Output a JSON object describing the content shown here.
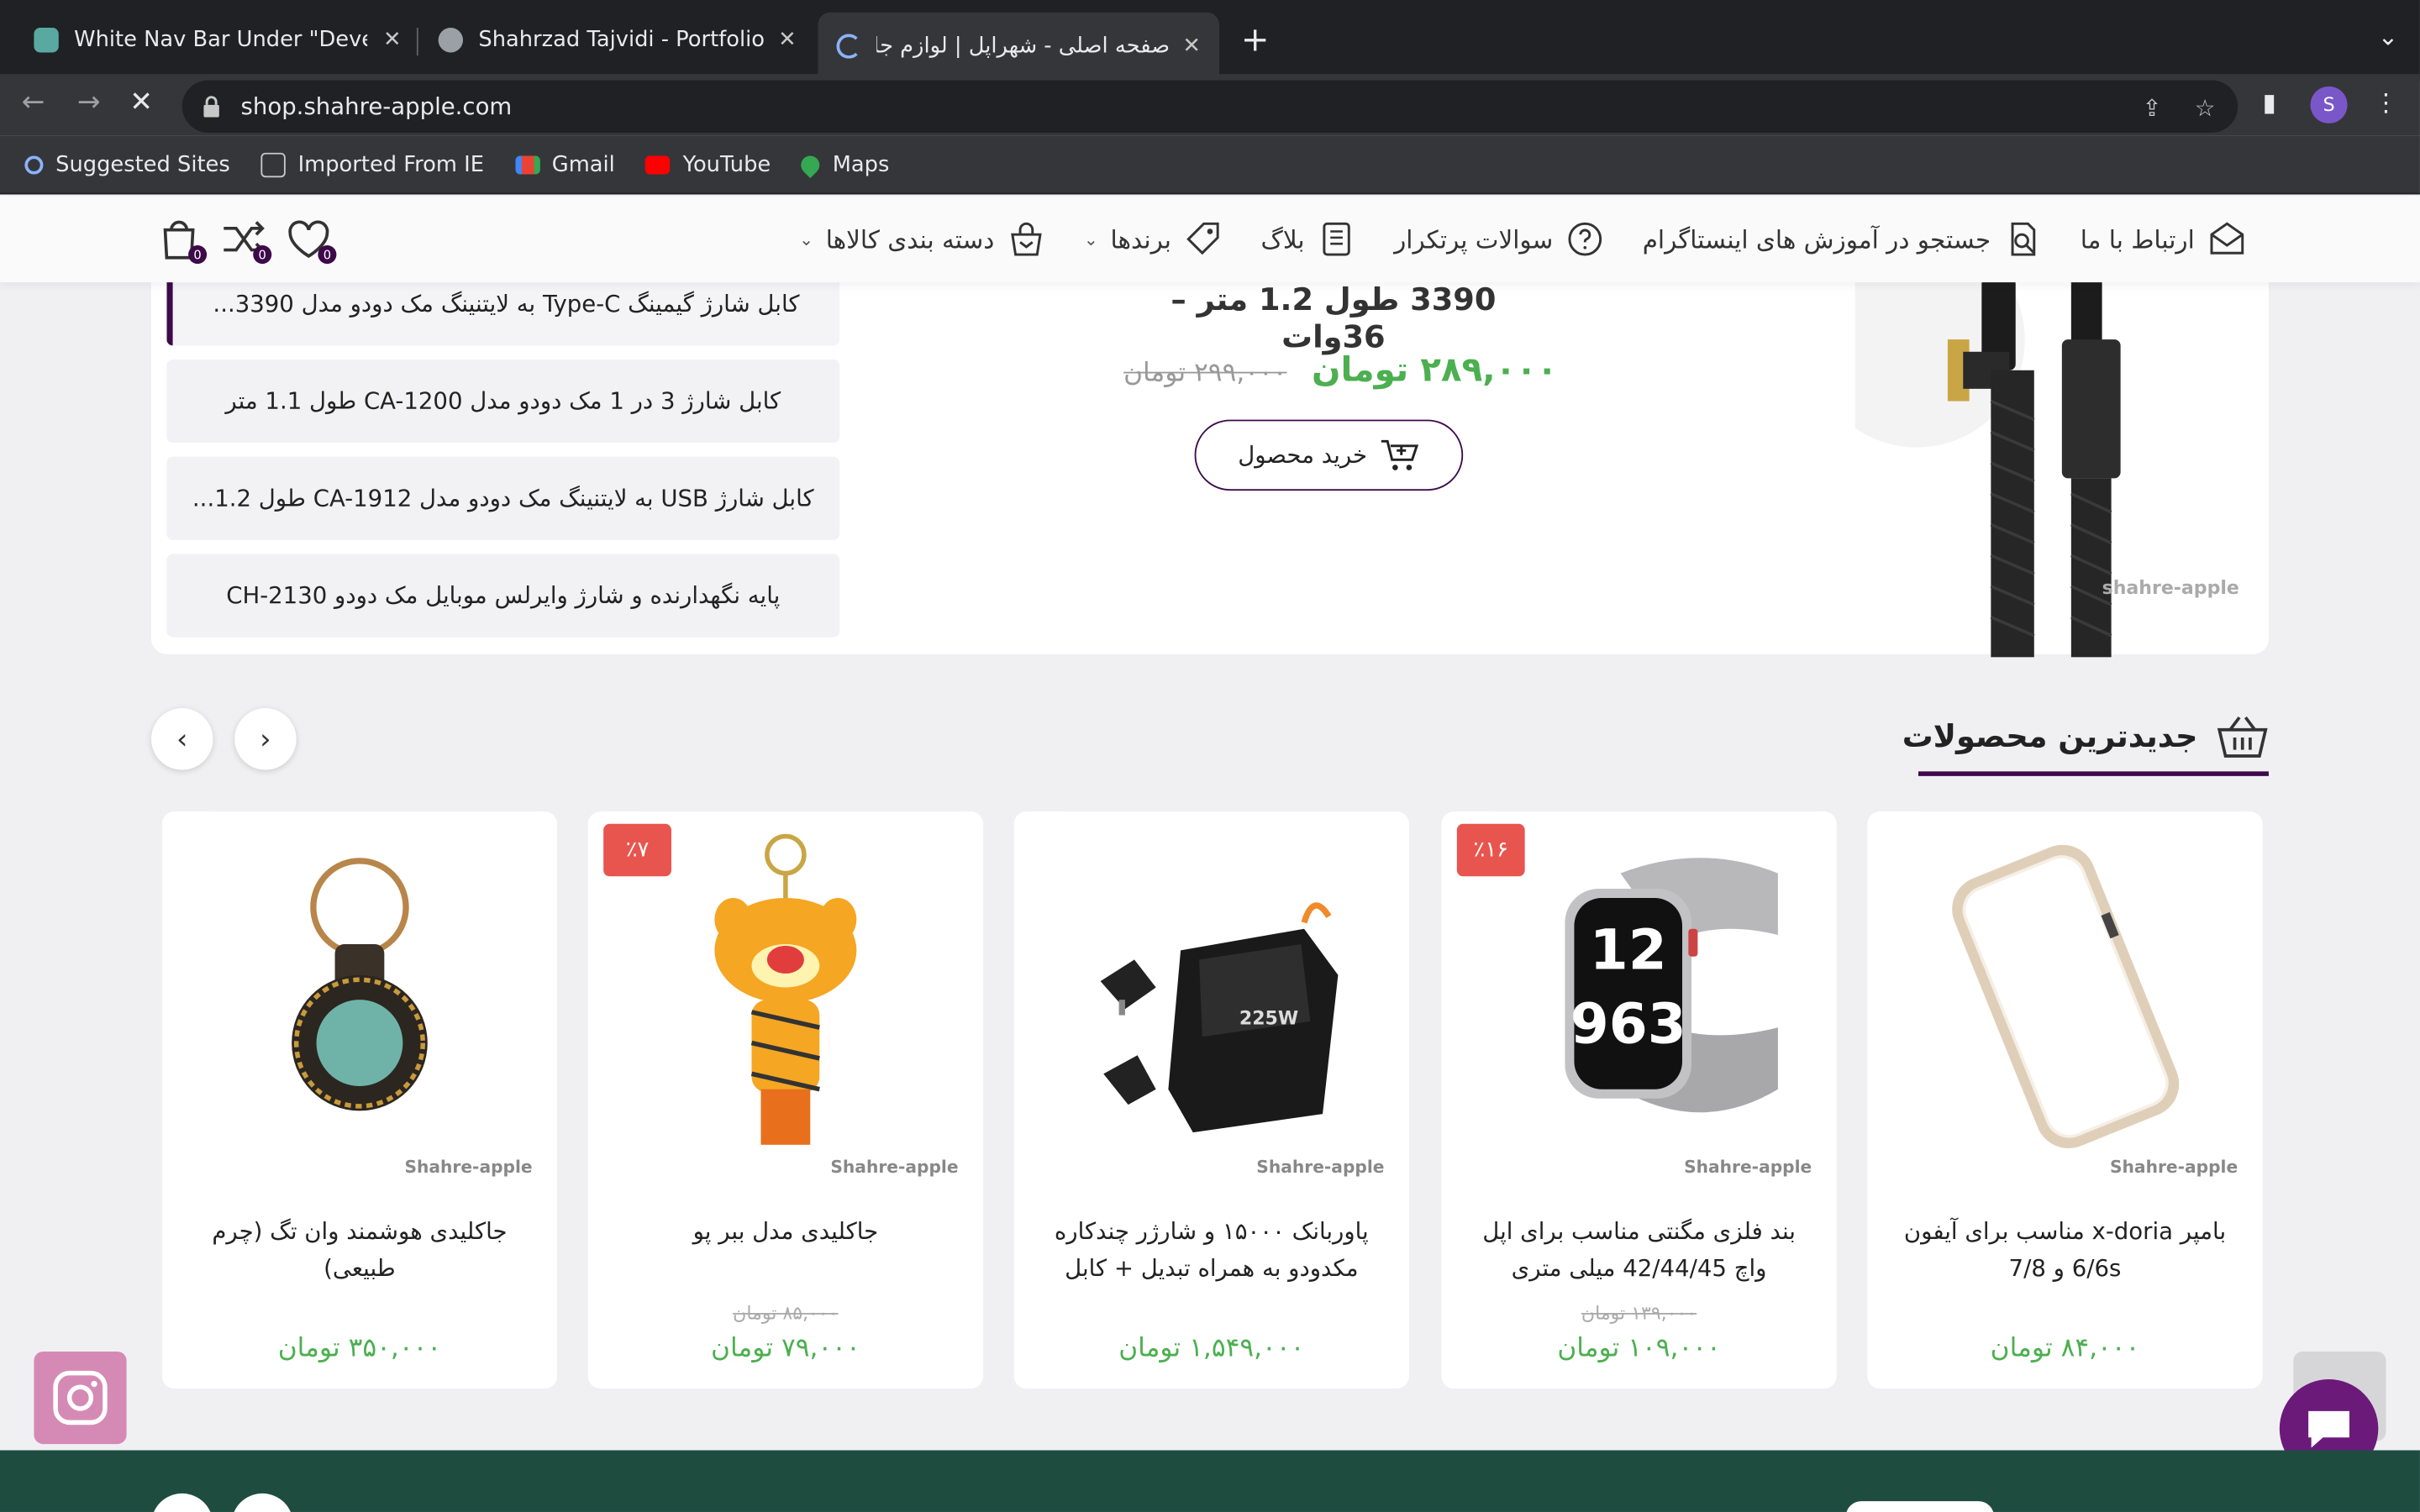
{
  "browser": {
    "tabs": [
      {
        "title": "White Nav Bar Under \"Develop",
        "close": "✕"
      },
      {
        "title": "Shahrzad Tajvidi - Portfolio",
        "close": "✕"
      },
      {
        "title": "صفحه اصلی - شهراپل | لوازم جانبی ا",
        "close": "✕"
      }
    ],
    "new_tab": "+",
    "url": "shop.shahre-apple.com",
    "avatar_letter": "S",
    "bookmarks": [
      {
        "label": "Suggested Sites",
        "icon": "search-icon"
      },
      {
        "label": "Imported From IE",
        "icon": "folder-icon"
      },
      {
        "label": "Gmail",
        "icon": "gmail-icon"
      },
      {
        "label": "YouTube",
        "icon": "youtube-icon"
      },
      {
        "label": "Maps",
        "icon": "maps-icon"
      }
    ]
  },
  "site": {
    "nav": [
      {
        "label": "دسته بندی کالاها",
        "icon": "shopping-bag-icon",
        "dropdown": true
      },
      {
        "label": "برندها",
        "icon": "tag-icon",
        "dropdown": true
      },
      {
        "label": "بلاگ",
        "icon": "blog-icon",
        "dropdown": false
      },
      {
        "label": "سوالات پرتکرار",
        "icon": "question-icon",
        "dropdown": false
      },
      {
        "label": "جستجو در آموزش های اینستاگرام",
        "icon": "search-doc-icon",
        "dropdown": false
      },
      {
        "label": "ارتباط با ما",
        "icon": "mail-icon",
        "dropdown": false
      }
    ],
    "header_icons": [
      {
        "name": "cart-icon",
        "count": "0"
      },
      {
        "name": "compare-icon",
        "count": "0"
      },
      {
        "name": "wishlist-icon",
        "count": "0"
      }
    ],
    "colors": {
      "accent": "#3d0a4a",
      "price": "#4caf50",
      "badge": "#e8554e",
      "footer": "#1e4d40"
    }
  },
  "featured": {
    "list": [
      "کابل شارژ گیمینگ Type-C به لایتنینگ مک دودو مدل 3390...",
      "کابل شارژ 3 در 1 مک دودو مدل CA-1200 طول 1.1 متر",
      "کابل شارژ USB به لایتنینگ مک دودو مدل CA-1912 طول 1.2...",
      "پایه نگهدارنده و شارژ وایرلس موبایل مک دودو CH-2130"
    ],
    "title": "3390 طول 1.2 متر – 36وات",
    "old_price": "۲۹۹,۰۰۰ تومان",
    "new_price": "۲۸۹,۰۰۰ تومان",
    "buy_label": "خرید محصول",
    "watermark": "shahre-apple"
  },
  "newest": {
    "title": "جدیدترین محصولات",
    "prev": "‹",
    "next": "›",
    "products": [
      {
        "name": "بامپر x-doria مناسب برای آیفون 6/6s و 7/8",
        "old_price": "",
        "price": "۸۴,۰۰۰ تومان",
        "badge": "",
        "watermark": "Shahre-apple"
      },
      {
        "name": "بند فلزی مگنتی مناسب برای اپل واچ 42/44/45 میلی متری",
        "old_price": "۱۳۹,۰۰۰ تومان",
        "price": "۱۰۹,۰۰۰ تومان",
        "badge": "٪۱۶",
        "watermark": "Shahre-apple"
      },
      {
        "name": "پاوربانک ۱۵۰۰۰ و شارژر چندکاره مکدودو به همراه تبدیل + کابل",
        "old_price": "",
        "price": "۱,۵۴۹,۰۰۰ تومان",
        "badge": "",
        "watermark": "Shahre-apple"
      },
      {
        "name": "جاکلیدی مدل ببر پو",
        "old_price": "۸۵,۰۰۰ تومان",
        "price": "۷۹,۰۰۰ تومان",
        "badge": "٪۷",
        "watermark": "Shahre-apple"
      },
      {
        "name": "جاکلیدی هوشمند وان تگ (چرم طبیعی)",
        "old_price": "",
        "price": "۳۵۰,۰۰۰ تومان",
        "badge": "",
        "watermark": "Shahre-apple"
      }
    ]
  }
}
